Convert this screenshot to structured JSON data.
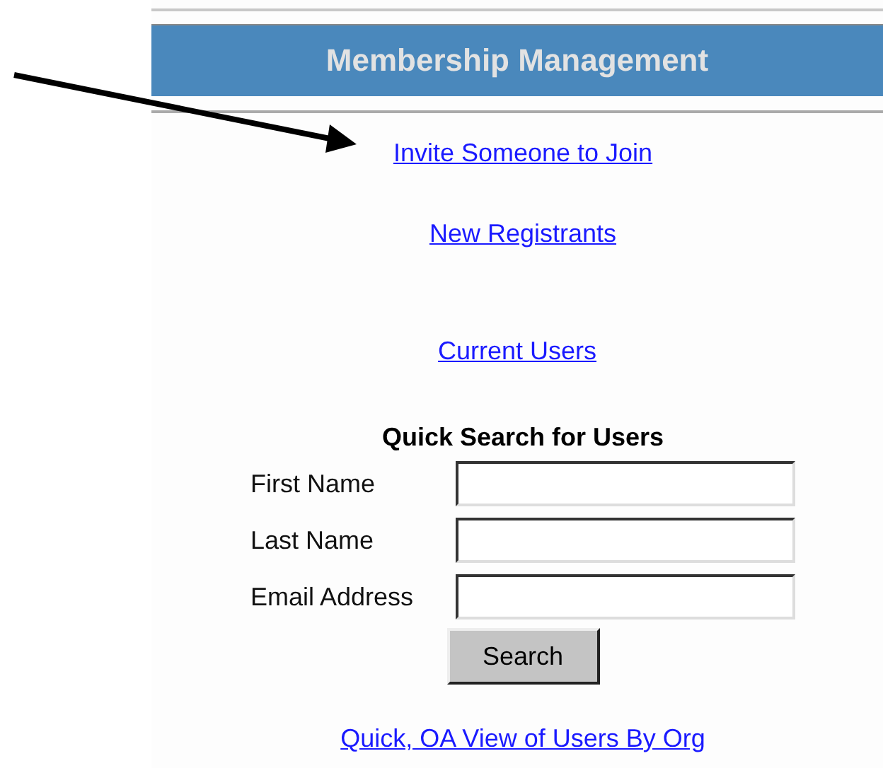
{
  "header": {
    "title": "Membership Management"
  },
  "links": [
    {
      "label": "Invite Someone to Join",
      "kind": "link"
    },
    {
      "label": "New Registrants",
      "kind": "link"
    },
    {
      "label": "Current Users",
      "kind": "link"
    }
  ],
  "quick_search": {
    "title": "Quick Search for Users",
    "fields": [
      {
        "label": "First Name"
      },
      {
        "label": "Last Name"
      },
      {
        "label": "Email Address"
      }
    ],
    "button": "Search"
  },
  "footer_link": "Quick, OA View of Users By Org"
}
